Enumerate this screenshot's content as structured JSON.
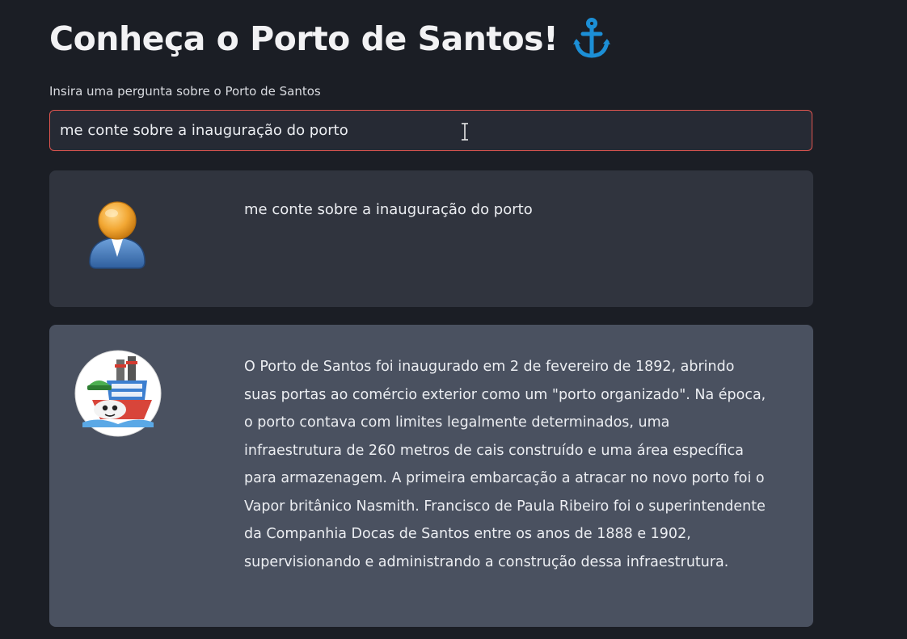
{
  "header": {
    "title": "Conheça o Porto de Santos!",
    "title_icon": "anchor-icon",
    "accent_color": "#1c8fd6"
  },
  "question_input": {
    "label": "Insira uma pergunta sobre o Porto de Santos",
    "value": "me conte sobre a inauguração do porto",
    "border_color": "#e0554f"
  },
  "chat": {
    "messages": [
      {
        "role": "user",
        "avatar_icon": "user-avatar-icon",
        "text": "me conte sobre a inauguração do porto"
      },
      {
        "role": "assistant",
        "avatar_icon": "ship-mascot-avatar-icon",
        "text": "O Porto de Santos foi inaugurado em 2 de fevereiro de 1892, abrindo suas portas ao comércio exterior como um \"porto organizado\". Na época, o porto contava com limites legalmente determinados, uma infraestrutura de 260 metros de cais construído e uma área específica para armazenagem. A primeira embarcação a atracar no novo porto foi o Vapor britânico Nasmith. Francisco de Paula Ribeiro foi o superintendente da Companhia Docas de Santos entre os anos de 1888 e 1902, supervisionando e administrando a construção dessa infraestrutura."
      }
    ]
  }
}
